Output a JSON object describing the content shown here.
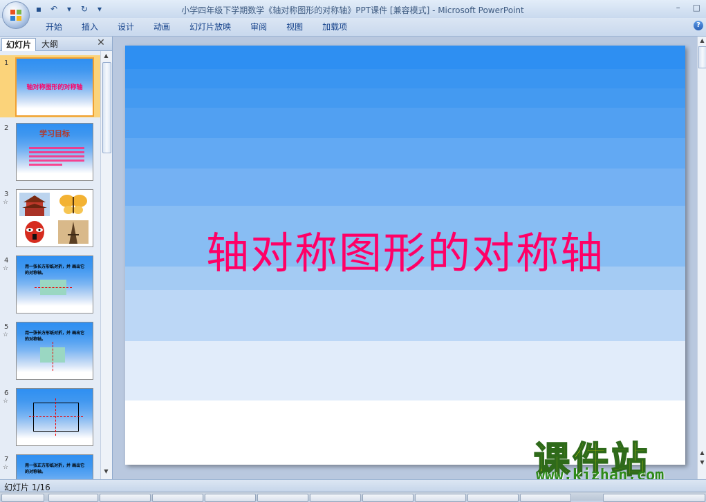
{
  "window": {
    "title": "小学四年级下学期数学《轴对称图形的对称轴》PPT课件 [兼容模式] - Microsoft PowerPoint",
    "controls": [
      "–",
      "□"
    ]
  },
  "qat": {
    "icons": [
      "save-icon",
      "undo-icon",
      "dropdown-icon",
      "redo-icon",
      "customize-icon"
    ],
    "glyphs": [
      "▪",
      "↶",
      "▾",
      "↻",
      "▾"
    ]
  },
  "ribbon": {
    "tabs": [
      "开始",
      "插入",
      "设计",
      "动画",
      "幻灯片放映",
      "审阅",
      "视图",
      "加载项"
    ],
    "help": "?"
  },
  "panel": {
    "tab_slides": "幻灯片",
    "tab_outline": "大纲",
    "close": "✕",
    "slides": [
      {
        "num": "1",
        "title": "轴对称图形的对称轴"
      },
      {
        "num": "2",
        "title": "学习目标"
      },
      {
        "num": "3"
      },
      {
        "num": "4",
        "text": "用一张长方形纸对折，并 画出它的对称轴。"
      },
      {
        "num": "5",
        "text": "用一张长方形纸对折，并 画出它的对称轴。"
      },
      {
        "num": "6"
      },
      {
        "num": "7",
        "text": "用一张正方形纸对折，并 画出它的对称轴。"
      }
    ]
  },
  "slide": {
    "title": "轴对称图形的对称轴",
    "title_color": "#ff0066"
  },
  "watermark": {
    "logo": "课件站",
    "url": "www.kjzhan.com"
  },
  "status": {
    "text": "幻灯片 1/16"
  }
}
